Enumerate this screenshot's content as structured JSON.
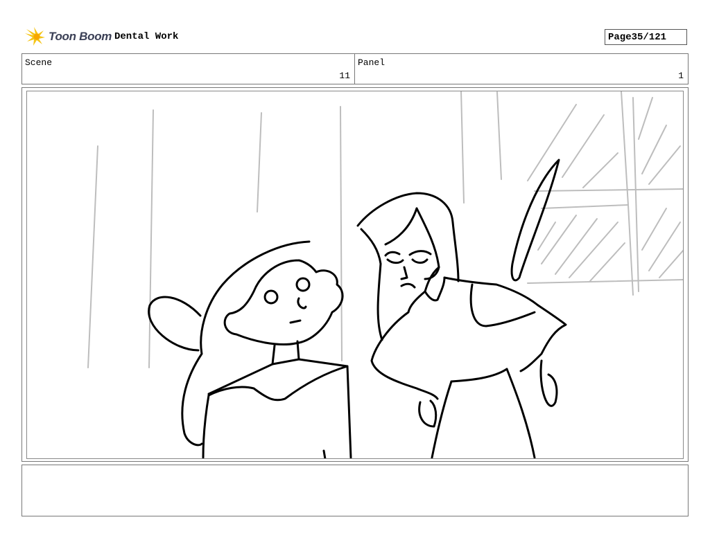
{
  "header": {
    "logo_text": "Toon Boom",
    "project_title": "Dental Work",
    "page_label": "Page",
    "page_value": "35/121"
  },
  "info": {
    "scene_label": "Scene",
    "scene_value": "11",
    "panel_label": "Panel",
    "panel_value": "1"
  },
  "notes": {
    "text": ""
  },
  "colors": {
    "logo_accent": "#f5c518",
    "sketch_line": "#000000",
    "background_line": "#bdbdbd"
  }
}
